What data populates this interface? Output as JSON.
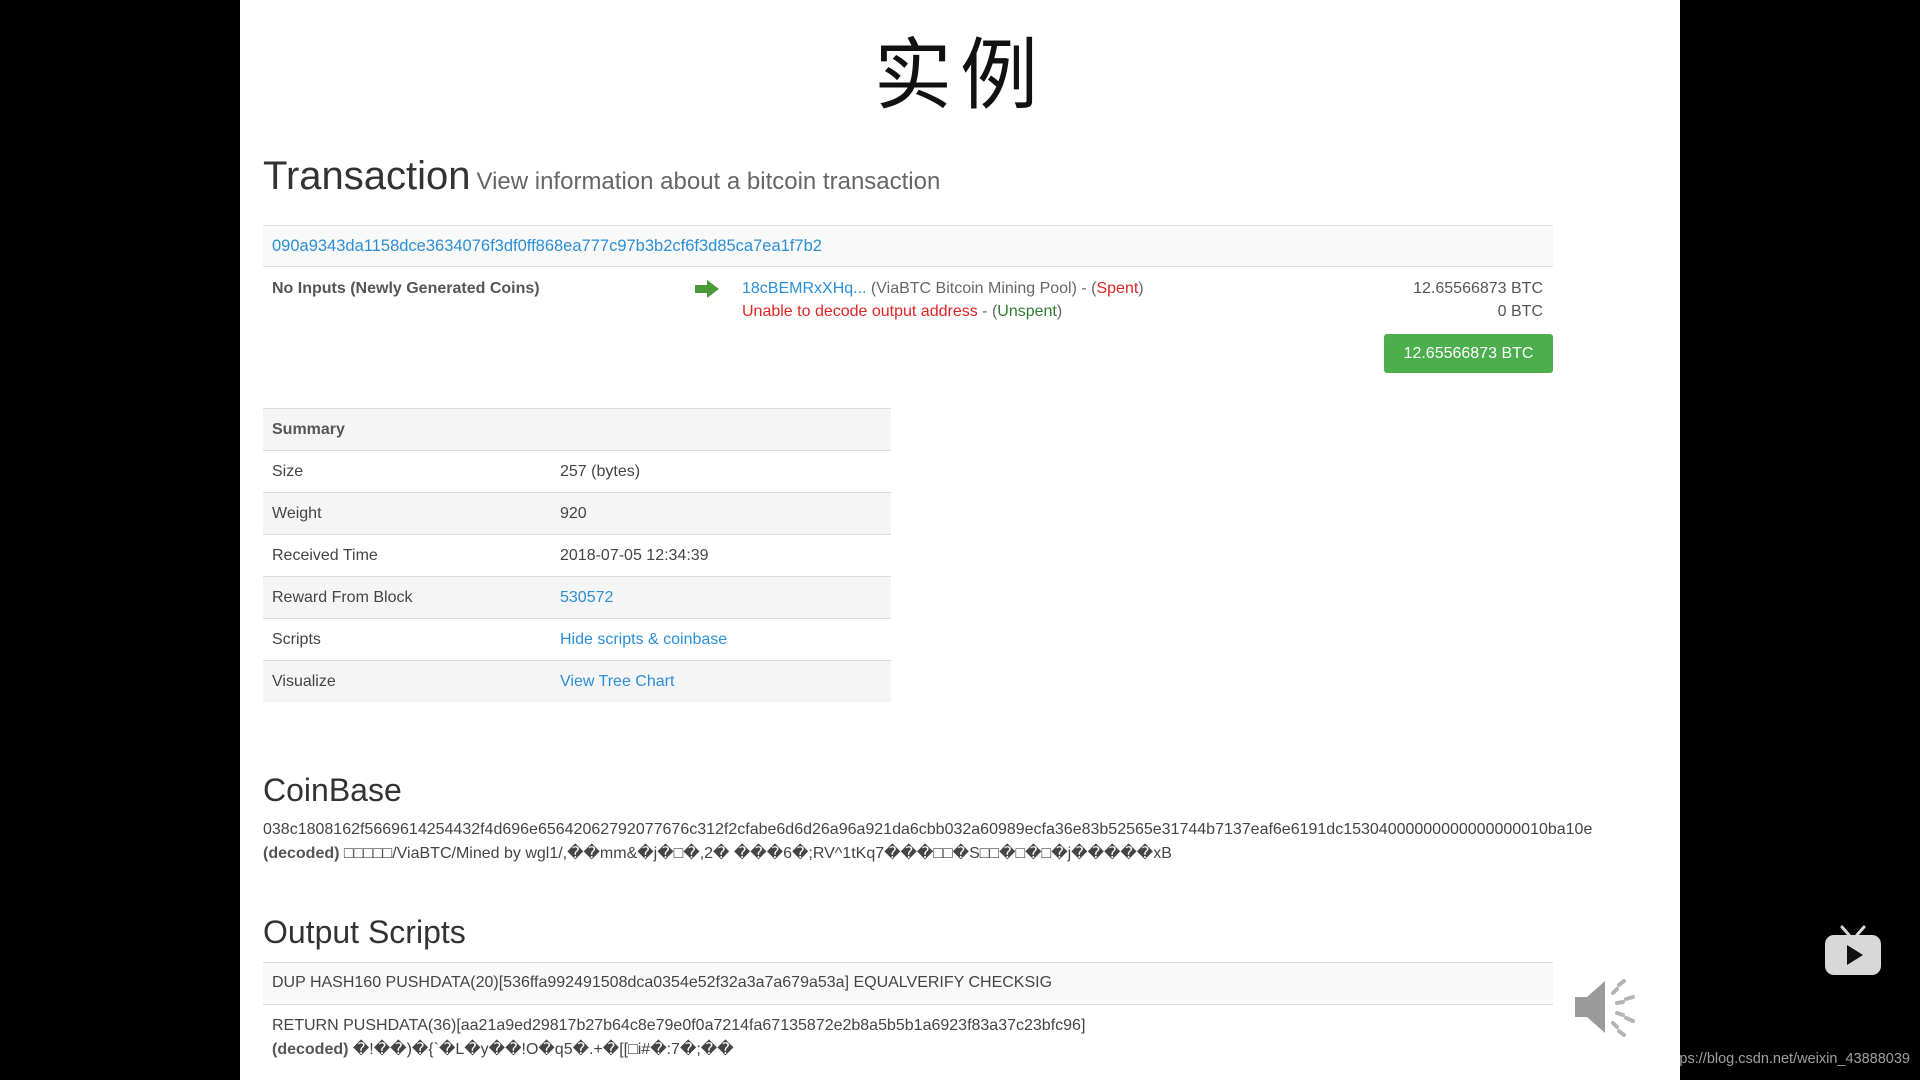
{
  "slide": {
    "title": "实例"
  },
  "transaction": {
    "heading": "Transaction",
    "subheading": "View information about a bitcoin transaction",
    "hash": "090a9343da1158dce3634076f3df0ff868ea777c97b3b2cf6f3d85ca7ea1f7b2",
    "inputs_label": "No Inputs (Newly Generated Coins)",
    "outputs": [
      {
        "address": "18cBEMRxXHq...",
        "pool": " (ViaBTC Bitcoin Mining Pool) - (",
        "status": "Spent",
        "close": ")",
        "amount": "12.65566873 BTC"
      },
      {
        "address": "Unable to decode output address",
        "sep": " - (",
        "status": "Unspent",
        "close": ")",
        "amount": "0 BTC"
      }
    ],
    "total": "12.65566873 BTC"
  },
  "summary": {
    "header": "Summary",
    "rows": [
      {
        "label": "Size",
        "value": "257 (bytes)"
      },
      {
        "label": "Weight",
        "value": "920"
      },
      {
        "label": "Received Time",
        "value": "2018-07-05 12:34:39"
      },
      {
        "label": "Reward From Block",
        "value": "530572"
      },
      {
        "label": "Scripts",
        "value": "Hide scripts & coinbase"
      },
      {
        "label": "Visualize",
        "value": "View Tree Chart"
      }
    ]
  },
  "coinbase": {
    "heading": "CoinBase",
    "hex": "038c1808162f5669614254432f4d696e65642062792077676c312f2cfabe6d6d26a96a921da6cbb032a60989ecfa36e83b52565e31744b7137eaf6e6191dc15304000000000000000010ba10e",
    "decoded_label": "(decoded)",
    "decoded": " □□□□□/ViaBTC/Mined by wgl1/,��mm&�j�□�,2� ���6�;RV^1tKq7���□□�S□□�□�□�j�����xB"
  },
  "output_scripts": {
    "heading": "Output Scripts",
    "rows": [
      {
        "script": "DUP HASH160 PUSHDATA(20)[536ffa992491508dca0354e52f32a3a7a679a53a] EQUALVERIFY CHECKSIG"
      },
      {
        "script": "RETURN PUSHDATA(36)[aa21a9ed29817b27b64c8e79e0f0a7214fa67135872e2b8a5b5b1a6923f83a37c23bfc96]",
        "decoded_label": "(decoded)",
        "decoded": " �!��)�{`�L�y��!O�q5�.+�[[□i#�:7�;��"
      }
    ]
  },
  "player": {
    "watermark": "https://blog.csdn.net/weixin_43888039"
  },
  "icons": {
    "arrow": "arrow-right-icon",
    "speaker": "speaker-icon",
    "play": "play-icon"
  },
  "colors": {
    "link": "#2b8fd6",
    "spent": "#e02424",
    "unspent": "#2e7d32",
    "total_button": "#4cae4c",
    "arrow": "#4a9a3a"
  }
}
